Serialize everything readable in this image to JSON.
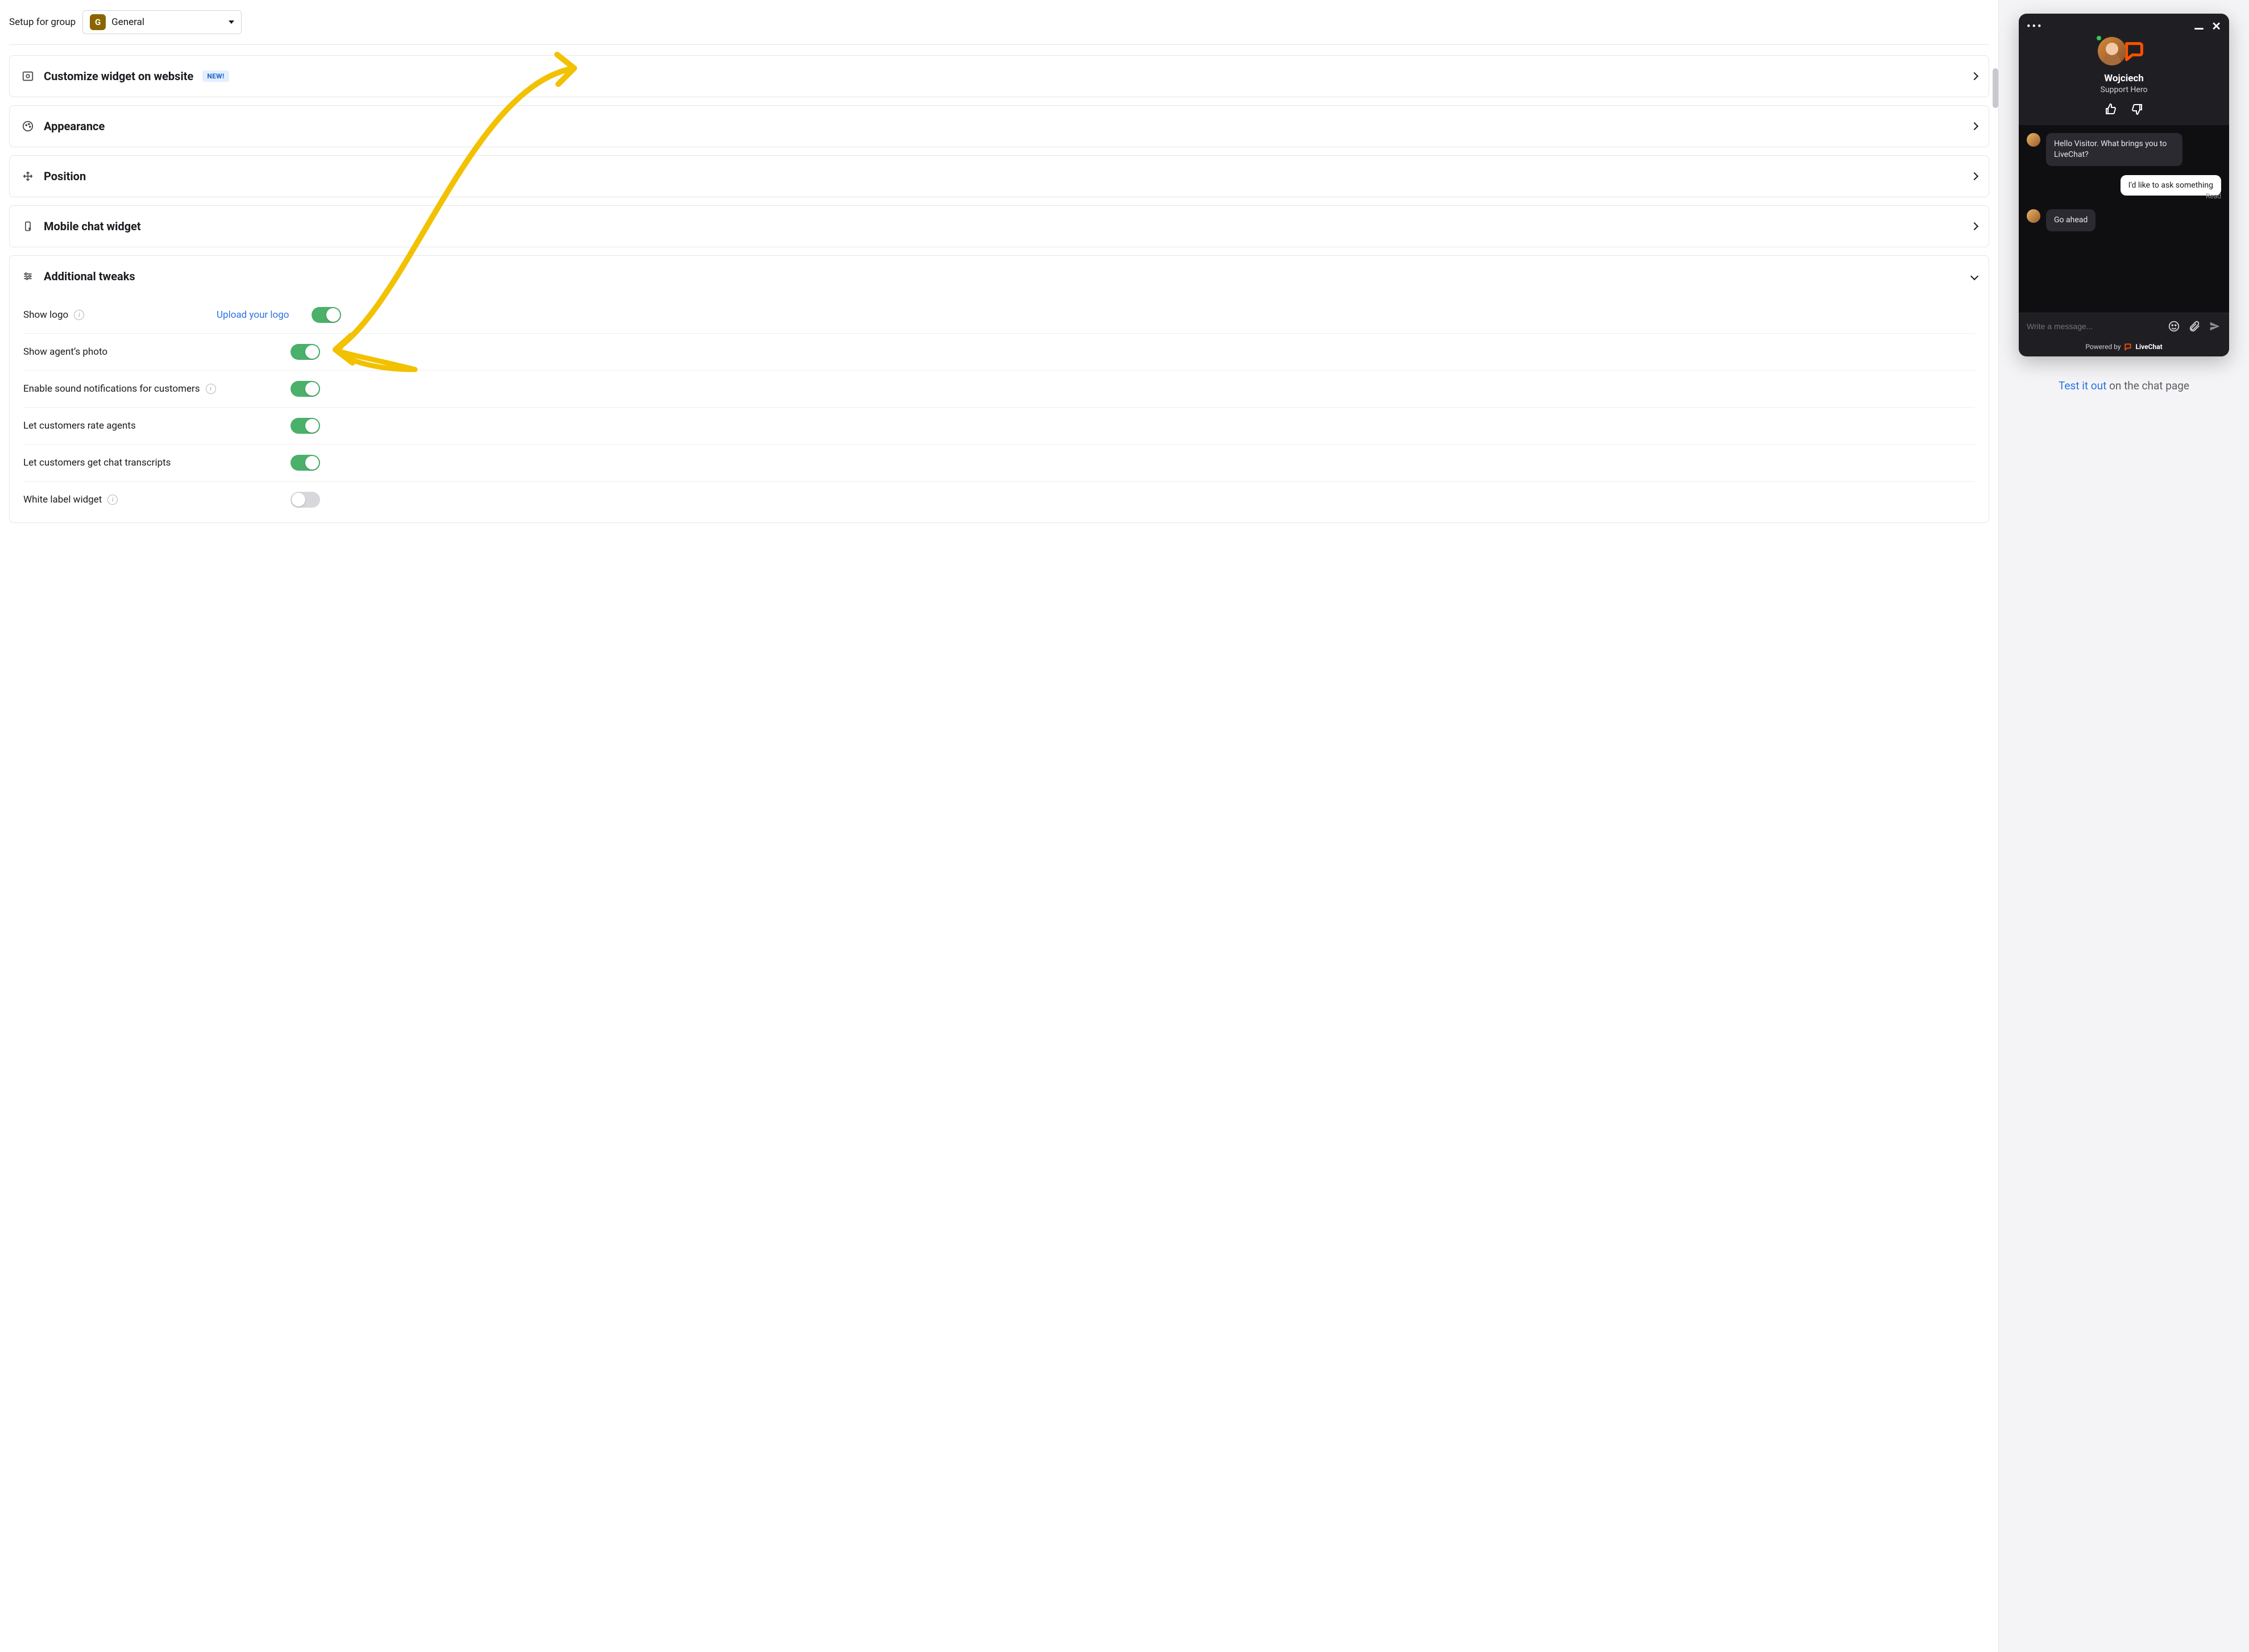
{
  "setup": {
    "label": "Setup for group",
    "group_badge": "G",
    "group_name": "General"
  },
  "panels": {
    "customize": {
      "title": "Customize widget on website",
      "badge": "NEW!"
    },
    "appearance": {
      "title": "Appearance"
    },
    "position": {
      "title": "Position"
    },
    "mobile": {
      "title": "Mobile chat widget"
    },
    "tweaks": {
      "title": "Additional tweaks"
    }
  },
  "tweaks": {
    "upload_link": "Upload your logo",
    "items": [
      {
        "label": "Show logo",
        "info": true,
        "on": true,
        "has_link": true
      },
      {
        "label": "Show agent’s photo",
        "info": false,
        "on": true,
        "has_link": false
      },
      {
        "label": "Enable sound notifications for customers",
        "info": true,
        "on": true,
        "has_link": false
      },
      {
        "label": "Let customers rate agents",
        "info": false,
        "on": true,
        "has_link": false
      },
      {
        "label": "Let customers get chat transcripts",
        "info": false,
        "on": true,
        "has_link": false
      },
      {
        "label": "White label widget",
        "info": true,
        "on": false,
        "has_link": false
      }
    ]
  },
  "chat": {
    "agent_name": "Wojciech",
    "agent_title": "Support Hero",
    "messages": {
      "m1": "Hello Visitor. What brings you to LiveChat?",
      "m2": "I'd like to ask something",
      "m2_status": "Read",
      "m3": "Go ahead"
    },
    "input_placeholder": "Write a message...",
    "powered_label": "Powered by",
    "powered_brand": "LiveChat"
  },
  "cta": {
    "link": "Test it out",
    "rest": " on the chat page"
  }
}
